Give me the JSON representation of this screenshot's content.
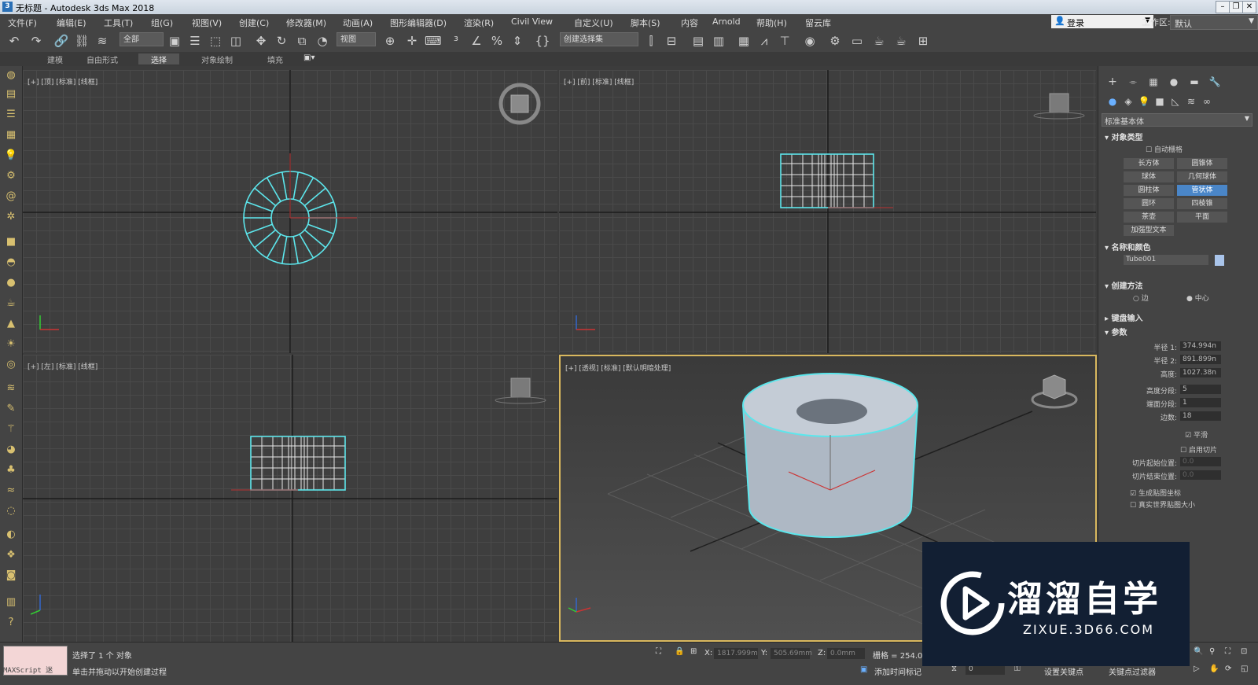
{
  "window": {
    "title": "无标题 - Autodesk 3ds Max 2018",
    "app_badge": "3"
  },
  "menubar": {
    "items": [
      "文件(F)",
      "编辑(E)",
      "工具(T)",
      "组(G)",
      "视图(V)",
      "创建(C)",
      "修改器(M)",
      "动画(A)",
      "图形编辑器(D)",
      "渲染(R)",
      "Civil View",
      "自定义(U)",
      "脚本(S)",
      "内容",
      "Arnold",
      "帮助(H)",
      "留云库"
    ],
    "login": "登录",
    "workspace_label": "工作区:",
    "workspace_value": "默认"
  },
  "toolbar": {
    "selection_filter": "全部",
    "ref_coord": "视图",
    "named_selection": "创建选择集"
  },
  "ribbon": {
    "tabs": [
      "建模",
      "自由形式",
      "选择",
      "对象绘制",
      "填充"
    ],
    "active_tab": "选择"
  },
  "viewports": {
    "top": "[+] [顶] [标准] [线框]",
    "front": "[+] [前] [标准] [线框]",
    "left": "[+] [左] [标准] [线框]",
    "perspective": "[+] [透视] [标准] [默认明暗处理]"
  },
  "command_panel": {
    "category": "标准基本体",
    "object_type_title": "对象类型",
    "autogrid": "自动栅格",
    "primitives": [
      "长方体",
      "圆锥体",
      "球体",
      "几何球体",
      "圆柱体",
      "管状体",
      "圆环",
      "四棱锥",
      "茶壶",
      "平面",
      "加强型文本"
    ],
    "active_primitive": "管状体",
    "name_color_title": "名称和颜色",
    "object_name": "Tube001",
    "object_color": "#a9c4ea",
    "creation_method_title": "创建方法",
    "creation_edge": "边",
    "creation_center": "中心",
    "keyboard_input_title": "键盘输入",
    "params_title": "参数",
    "params": [
      {
        "label": "半径 1:",
        "value": "374.994n",
        "enabled": true
      },
      {
        "label": "半径 2:",
        "value": "891.899n",
        "enabled": true
      },
      {
        "label": "高度:",
        "value": "1027.38n",
        "enabled": true
      },
      {
        "label": "高度分段:",
        "value": "5",
        "enabled": true
      },
      {
        "label": "端面分段:",
        "value": "1",
        "enabled": true
      },
      {
        "label": "边数:",
        "value": "18",
        "enabled": true
      }
    ],
    "smooth": "平滑",
    "slice_on": "启用切片",
    "slice_from": {
      "label": "切片起始位置:",
      "value": "0.0"
    },
    "slice_to": {
      "label": "切片结束位置:",
      "value": "0.0"
    },
    "gen_mapping": "生成贴图坐标",
    "real_world_map": "真实世界贴图大小"
  },
  "status": {
    "maxscript": "MAXScript 迷",
    "selected": "选择了 1 个 对象",
    "prompt": "单击并拖动以开始创建过程",
    "x_label": "X:",
    "x_value": "1817.999m",
    "y_label": "Y:",
    "y_value": "505.69mm",
    "z_label": "Z:",
    "z_value": "0.0mm",
    "grid": "栅格 = 254.0",
    "add_time_tag": "添加时间标记",
    "frame": "0",
    "set_key": "设置关键点",
    "key_filters": "关键点过滤器"
  },
  "watermark": {
    "name": "溜溜自学",
    "url": "ZIXUE.3D66.COM"
  },
  "colors": {
    "selection": "#5ce6ec",
    "active_viewport_border": "#d9b85e",
    "active_button": "#4a86c8"
  }
}
